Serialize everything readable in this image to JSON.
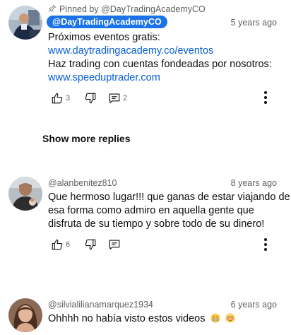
{
  "comments": [
    {
      "pinned_label": "Pinned by @DayTradingAcademyCO",
      "author": "@DayTradingAcademyCO",
      "time": "5 years ago",
      "lines": [
        "Próximos eventos gratis:",
        "www.daytradingacademy.co/eventos",
        "Haz trading con cuentas fondeadas por nosotros:",
        "www.speeduptrader.com"
      ],
      "like_count": "3",
      "reply_count": "2"
    },
    {
      "author": "@alanbenitez810",
      "time": "8 years ago",
      "lines": [
        "Que hermoso lugar!!! que ganas de estar viajando de",
        "esa forma como admiro en aquella gente que",
        "disfruta de su tiempo y sobre todo de su dinero!"
      ],
      "like_count": "6"
    },
    {
      "author": "@silvialilianamarquez1934",
      "time": "6 years ago",
      "lines": [
        "Ohhhh no había visto estos videos"
      ],
      "emojis": [
        "grimacing-face-emoji",
        "flushed-face-emoji"
      ]
    }
  ],
  "show_more_replies": "Show more replies",
  "icons": {
    "pin": "pin-icon",
    "like": "thumb-up-icon",
    "dislike": "thumb-down-icon",
    "reply": "comment-icon",
    "more": "more-vert-icon"
  },
  "colors": {
    "link": "#065fd4",
    "author_chip": "#1a73e8",
    "secondary_text": "#606060"
  }
}
